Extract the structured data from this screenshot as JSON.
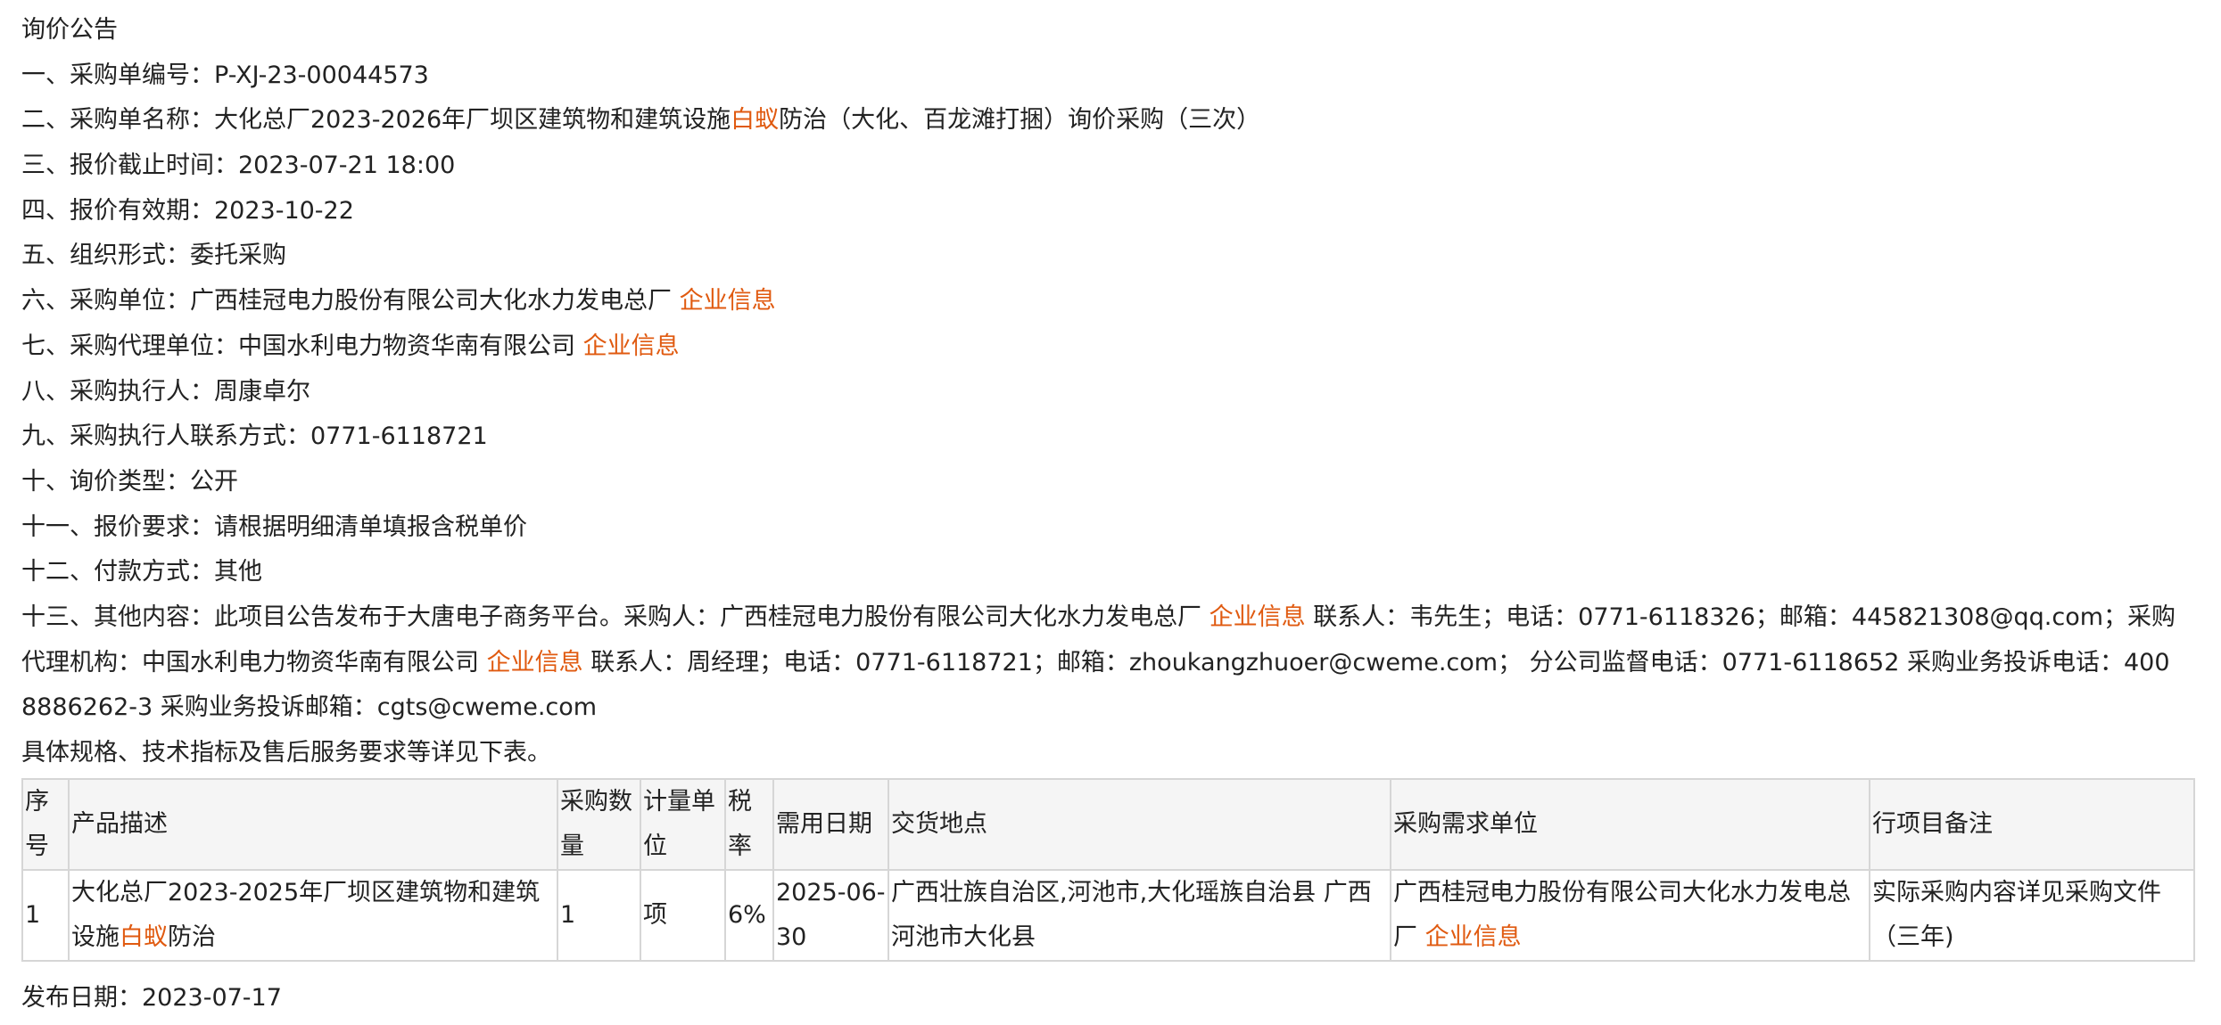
{
  "title": "询价公告",
  "fields": {
    "f1": "一、采购单编号：P-XJ-23-00044573",
    "f2_pre": "二、采购单名称：大化总厂2023-2026年厂坝区建筑物和建筑设施",
    "f2_hl": "白蚁",
    "f2_post": "防治（大化、百龙滩打捆）询价采购（三次）",
    "f3": "三、报价截止时间：2023-07-21 18:00",
    "f4": "四、报价有效期：2023-10-22",
    "f5": "五、组织形式：委托采购",
    "f6": "六、采购单位：广西桂冠电力股份有限公司大化水力发电总厂",
    "f7": "七、采购代理单位：中国水利电力物资华南有限公司",
    "f8": "八、采购执行人：周康卓尔",
    "f9": "九、采购执行人联系方式：0771-6118721",
    "f10": "十、询价类型：公开",
    "f11": "十一、报价要求：请根据明细清单填报含税单价",
    "f12": "十二、付款方式：其他",
    "f13_a": "十三、其他内容：此项目公告发布于大唐电子商务平台。采购人：广西桂冠电力股份有限公司大化水力发电总厂",
    "f13_b": "联系人：韦先生；电话：0771-6118326；邮箱：445821308@qq.com；采购代理机构：中国水利电力物资华南有限公司",
    "f13_c": "联系人：周经理；电话：0771-6118721；邮箱：zhoukangzhuoer@cweme.com； 分公司监督电话：0771-6118652 采购业务投诉电话：4008886262-3 采购业务投诉邮箱：cgts@cweme.com",
    "spec_note": "具体规格、技术指标及售后服务要求等详见下表。"
  },
  "company_link_label": "企业信息",
  "table": {
    "headers": {
      "seq": "序号",
      "desc": "产品描述",
      "qty": "采购数量",
      "unit": "计量单位",
      "tax": "税率",
      "date": "需用日期",
      "place": "交货地点",
      "dept": "采购需求单位",
      "remark": "行项目备注"
    },
    "row": {
      "seq": "1",
      "desc_pre": "大化总厂2023-2025年厂坝区建筑物和建筑设施",
      "desc_hl": "白蚁",
      "desc_post": "防治",
      "qty": "1",
      "unit": "项",
      "tax": "6%",
      "date": "2025-06-30",
      "place": "广西壮族自治区,河池市,大化瑶族自治县 广西河池市大化县",
      "dept": "广西桂冠电力股份有限公司大化水力发电总厂",
      "remark": "实际采购内容详见采购文件（三年)"
    }
  },
  "publish_date": "发布日期：2023-07-17",
  "colors": {
    "highlight": "#e05a10",
    "text": "#222222",
    "border": "#d6d6d6",
    "header_bg": "#f5f5f5"
  }
}
